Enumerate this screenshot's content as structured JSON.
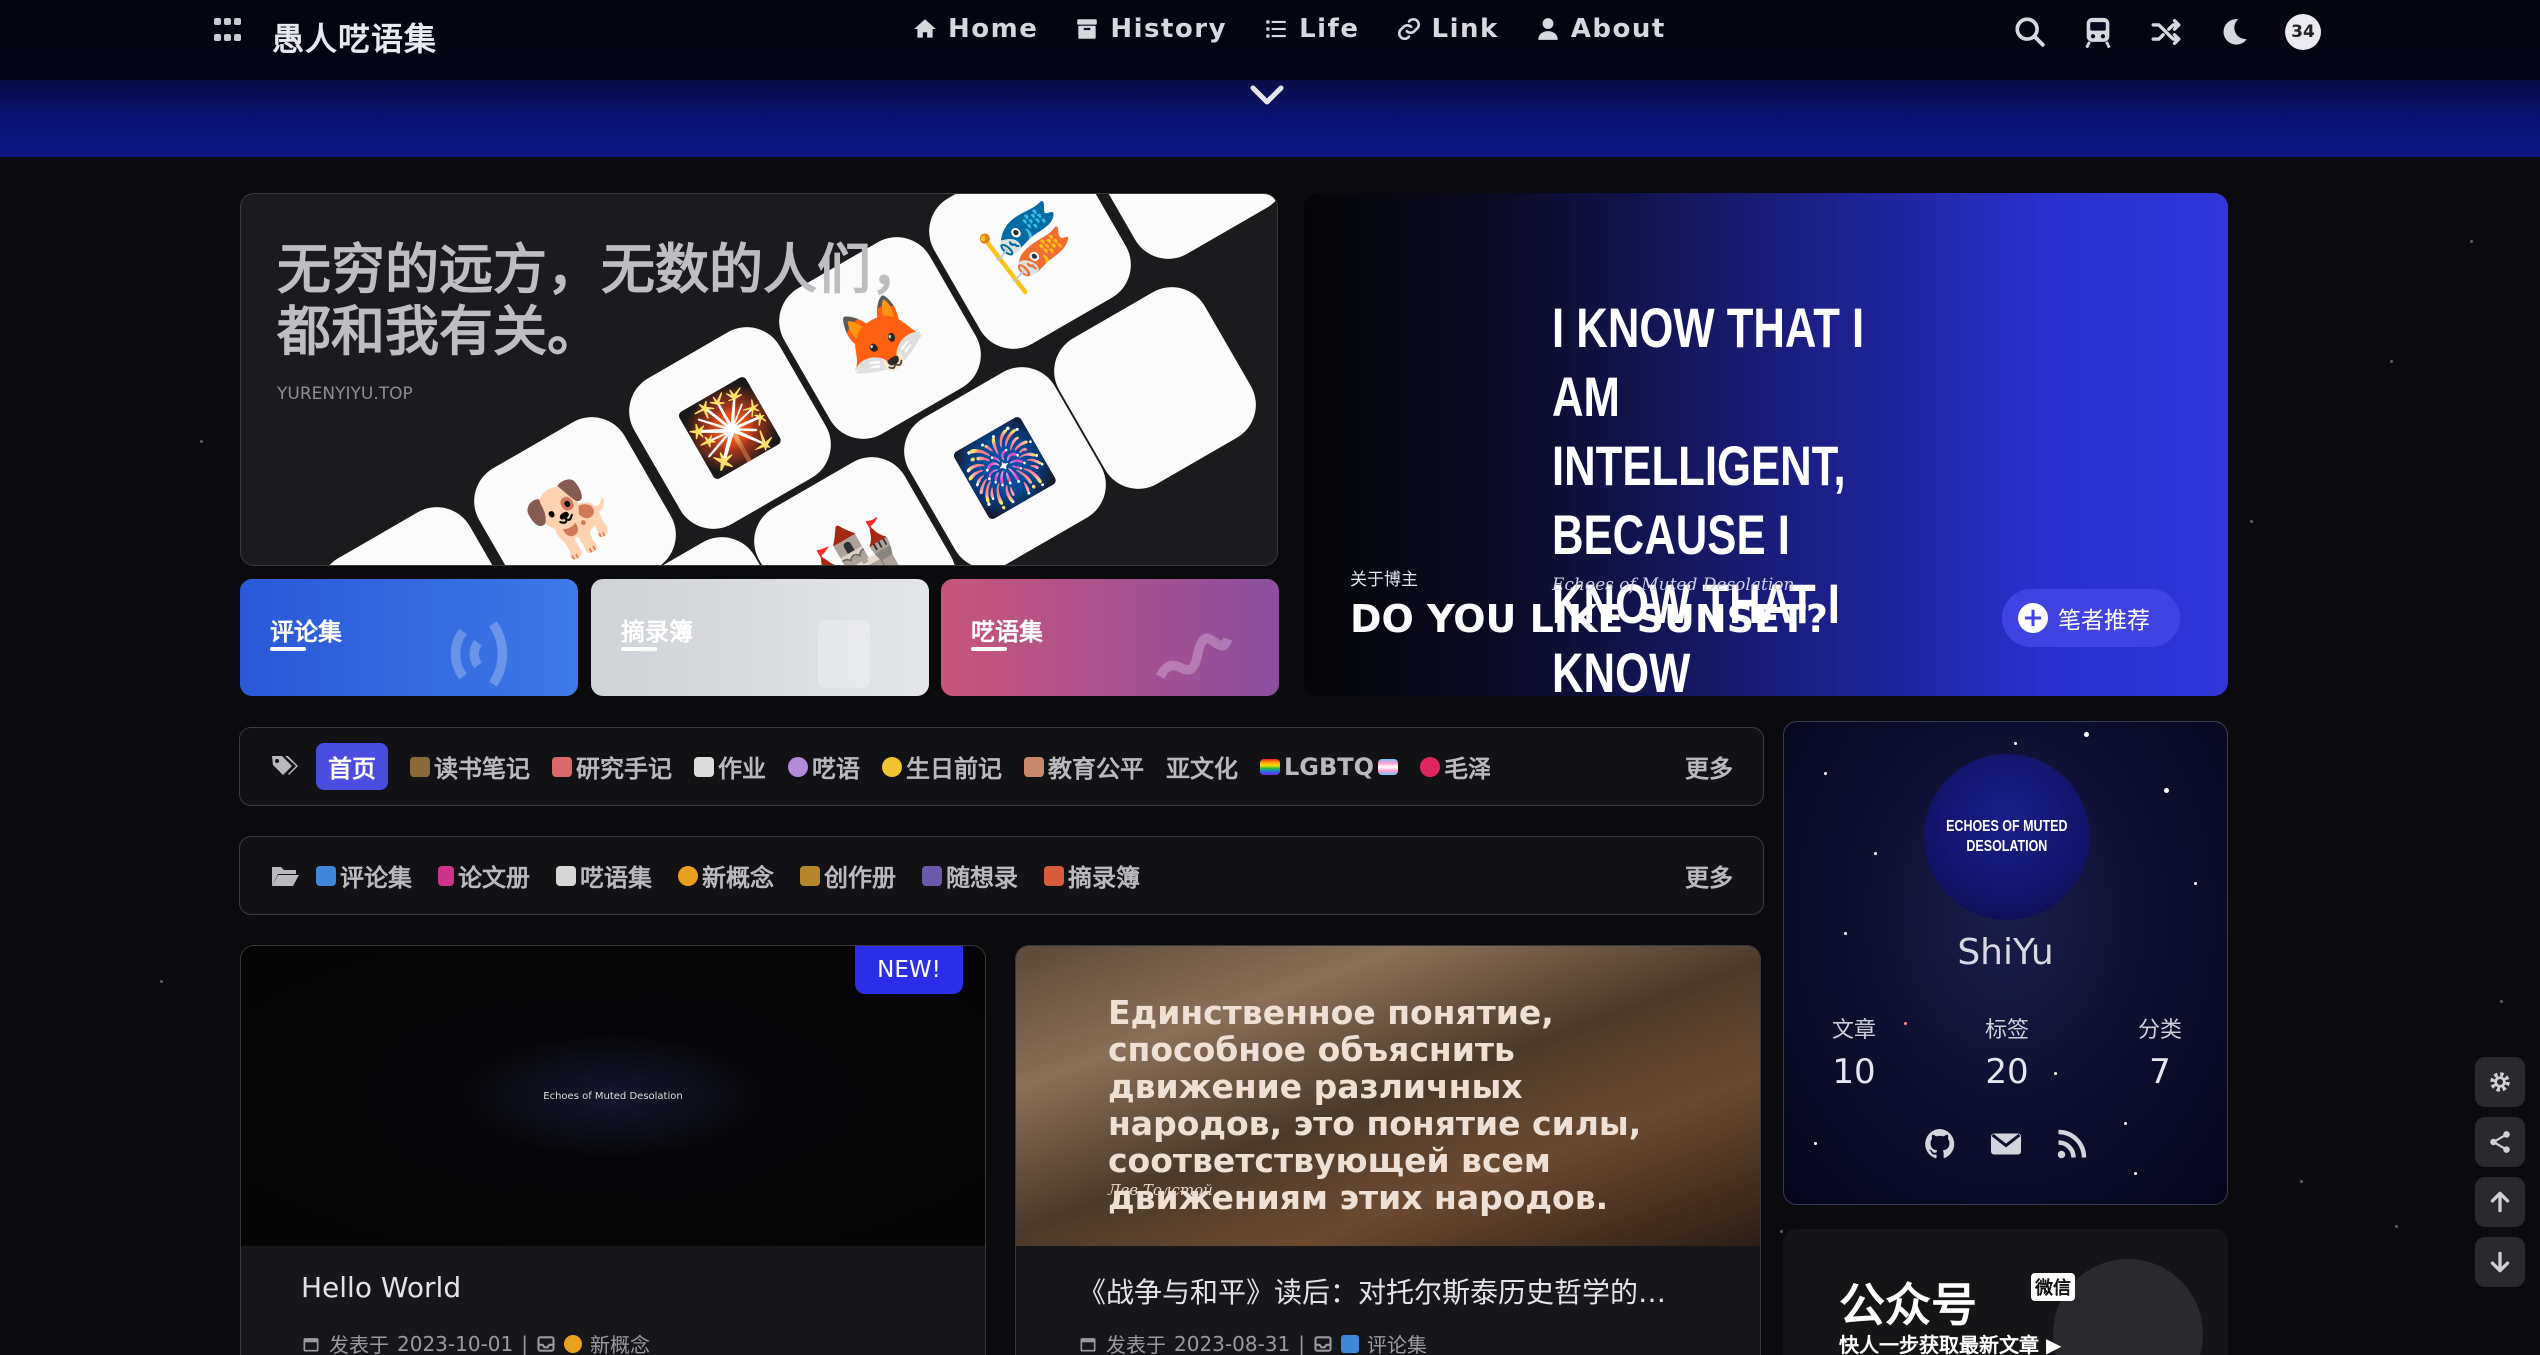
{
  "site": {
    "brand": "愚人呓语集"
  },
  "nav": {
    "items": [
      {
        "label": "Home",
        "icon": "home-icon"
      },
      {
        "label": "History",
        "icon": "archive-icon"
      },
      {
        "label": "Life",
        "icon": "list-icon"
      },
      {
        "label": "Link",
        "icon": "link-icon"
      },
      {
        "label": "About",
        "icon": "user-icon"
      }
    ],
    "right_icons": [
      "search-icon",
      "train-icon",
      "shuffle-icon",
      "moon-icon"
    ],
    "avatar_count": "34"
  },
  "hero": {
    "title": "无穷的远方，无数的人们，都和我有关。",
    "subtitle": "YURENYIYU.TOP"
  },
  "categories": [
    {
      "label": "评论集",
      "color_from": "#2a58d8",
      "color_to": "#3e7ae8"
    },
    {
      "label": "摘录簿",
      "color_from": "#cfd2d6",
      "color_to": "#e4e6e9"
    },
    {
      "label": "呓语集",
      "color_from": "#c8557a",
      "color_to": "#8d4ea0"
    }
  ],
  "feature": {
    "quote": "I KNOW THAT I AM INTELLIGENT, BECAUSE I KNOW THAT I KNOW NOTHING.",
    "source": "Echoes of Muted Desolation",
    "about_label": "关于博主",
    "headline": "DO YOU LIKE SUNSET?",
    "button": "笔者推荐"
  },
  "tags": {
    "items": [
      "首页",
      "读书笔记",
      "研究手记",
      "作业",
      "呓语",
      "生日前记",
      "教育公平",
      "亚文化",
      "LGBTQ",
      "毛泽东"
    ],
    "more": "更多"
  },
  "folders": {
    "items": [
      "评论集",
      "论文册",
      "呓语集",
      "新概念",
      "创作册",
      "随想录",
      "摘录簿"
    ],
    "more": "更多"
  },
  "profile": {
    "avatar_text_line1": "ECHOES OF MUTED",
    "avatar_text_line2": "DESOLATION",
    "name": "ShiYu",
    "stats": [
      {
        "label": "文章",
        "value": "10"
      },
      {
        "label": "标签",
        "value": "20"
      },
      {
        "label": "分类",
        "value": "7"
      }
    ]
  },
  "wechat": {
    "title": "公众号",
    "badge": "微信",
    "subtitle": "快人一步获取最新文章 ▶"
  },
  "posts": [
    {
      "badge": "NEW!",
      "cover_text": "Echoes of Muted Desolation",
      "title": "Hello World",
      "meta_prefix": "发表于",
      "date": "2023-10-01",
      "category": "新概念"
    },
    {
      "cover_text": "Единственное понятие, способное объяснить движение различных народов, это понятие силы, соответствующей всем движениям этих народов.",
      "cover_source": "Лев Толстой",
      "title": "《战争与和平》读后：对托尔斯泰历史哲学的…",
      "meta_prefix": "发表于",
      "date": "2023-08-31",
      "category": "评论集"
    }
  ]
}
